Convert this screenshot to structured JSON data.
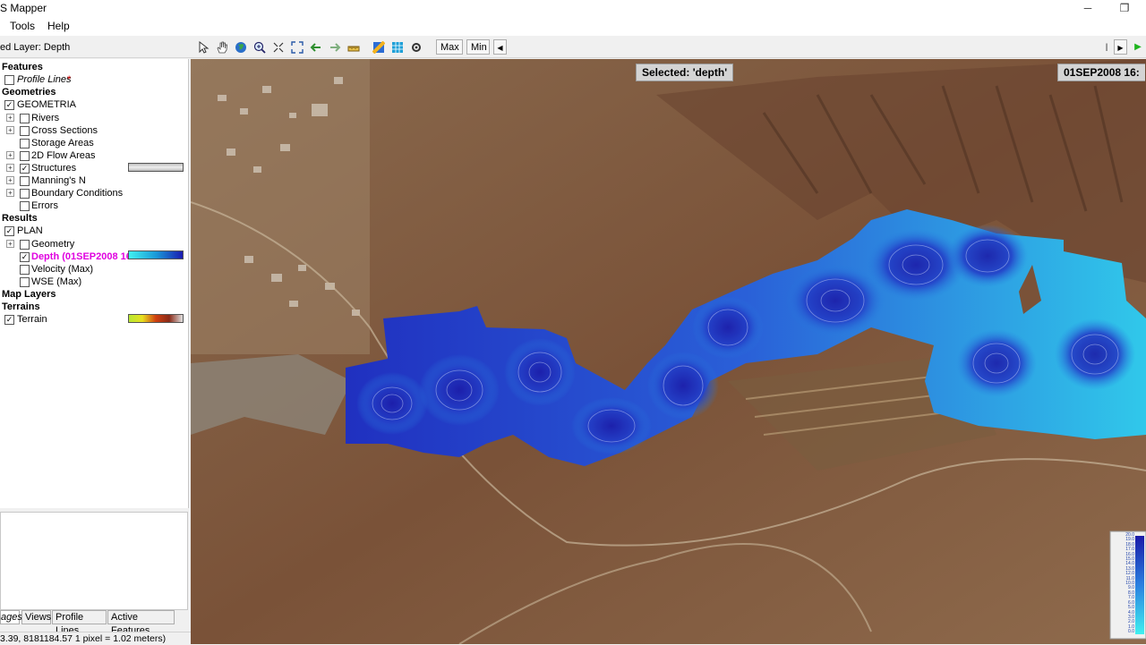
{
  "window": {
    "title": "S Mapper",
    "minimize": "─",
    "maximize": "❐"
  },
  "menu": {
    "items": [
      "Tools",
      "Help"
    ]
  },
  "toolbar": {
    "selected_layer": "ed Layer: Depth",
    "max_label": "Max",
    "min_label": "Min",
    "prev_label": "◀",
    "next_label": "▶",
    "end_label": "|",
    "play_label": "▶",
    "icons": [
      "pointer-icon",
      "pan-hand-icon",
      "globe-icon",
      "zoom-in-icon",
      "zoom-full-icon",
      "zoom-extents-icon",
      "back-arrow-icon",
      "forward-arrow-icon",
      "measure-icon",
      "layer-color-icon",
      "grid-icon",
      "settings-icon"
    ]
  },
  "tree": {
    "features_header": "Features",
    "profile_lines": "Profile Lines",
    "profile_star": "*",
    "geometries_header": "Geometries",
    "geometria": "GEOMETRIA",
    "geometry_items": [
      {
        "label": "Rivers",
        "checked": false,
        "expandable": true
      },
      {
        "label": "Cross Sections",
        "checked": false,
        "expandable": true
      },
      {
        "label": "Storage Areas",
        "checked": false,
        "expandable": false
      },
      {
        "label": "2D Flow Areas",
        "checked": false,
        "expandable": true
      },
      {
        "label": "Structures",
        "checked": true,
        "expandable": true
      },
      {
        "label": "Manning's N",
        "checked": false,
        "expandable": true
      },
      {
        "label": "Boundary Conditions",
        "checked": false,
        "expandable": true
      },
      {
        "label": "Errors",
        "checked": false,
        "expandable": false
      }
    ],
    "results_header": "Results",
    "plan": "PLAN",
    "plan_items": [
      {
        "label": "Geometry",
        "checked": false,
        "expandable": true
      },
      {
        "label": "Depth (01SEP2008 16",
        "checked": true,
        "expandable": false,
        "color": "#e000e0"
      },
      {
        "label": "Velocity (Max)",
        "checked": false,
        "expandable": false
      },
      {
        "label": "WSE (Max)",
        "checked": false,
        "expandable": false
      }
    ],
    "map_layers_header": "Map Layers",
    "terrains_header": "Terrains",
    "terrain": "Terrain"
  },
  "tabs": [
    "ages",
    "Views",
    "Profile Lines",
    "Active Features"
  ],
  "status": "3.39, 8181184.57  1 pixel = 1.02 meters)",
  "map": {
    "selected_label": "Selected: 'depth'",
    "timestamp": "01SEP2008 16:",
    "legend_ticks": [
      "20.0",
      "19.0",
      "18.0",
      "17.0",
      "16.0",
      "15.0",
      "14.0",
      "13.0",
      "12.0",
      "11.0",
      "10.0",
      "9.0",
      "8.0",
      "7.0",
      "6.0",
      "5.0",
      "4.0",
      "3.0",
      "2.0",
      "1.0",
      "0.0"
    ]
  },
  "colors": {
    "depth_deep": "#1a1aa8",
    "depth_shallow": "#33e6f0",
    "highlight_layer": "#e000e0"
  }
}
